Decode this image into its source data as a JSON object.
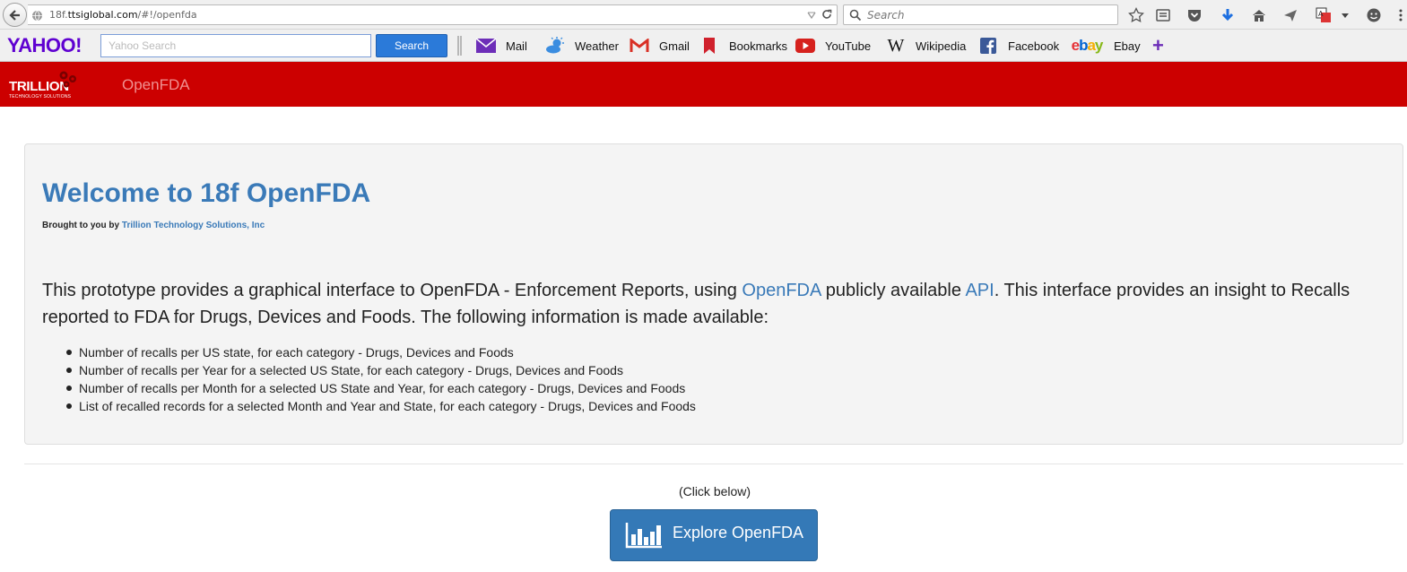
{
  "browser": {
    "url_host": "18f.ttsiglobal.com",
    "url_prefix": "18f.",
    "url_domain": "ttsiglobal.com",
    "url_path": "/#!/openfda",
    "search_placeholder": "Search"
  },
  "yahoo_toolbar": {
    "logo": "YAHOO!",
    "search_placeholder": "Yahoo Search",
    "search_button": "Search",
    "bookmarks": [
      {
        "label": "Mail",
        "icon": "mail-icon"
      },
      {
        "label": "Weather",
        "icon": "weather-icon"
      },
      {
        "label": "Gmail",
        "icon": "gmail-icon"
      },
      {
        "label": "Bookmarks",
        "icon": "bookmark-icon"
      },
      {
        "label": "YouTube",
        "icon": "youtube-icon"
      },
      {
        "label": "Wikipedia",
        "icon": "wikipedia-icon"
      },
      {
        "label": "Facebook",
        "icon": "facebook-icon"
      },
      {
        "label": "Ebay",
        "icon": "ebay-icon"
      }
    ],
    "add_label": "+"
  },
  "app_header": {
    "brand_name": "TRILLION",
    "brand_tagline": "TECHNOLOGY SOLUTIONS",
    "app_name": "OpenFDA"
  },
  "jumbotron": {
    "title": "Welcome to 18f OpenFDA",
    "byline_prefix": "Brought to you by",
    "byline_link": "Trillion Technology Solutions, Inc",
    "intro_part1": "This prototype provides a graphical interface to OpenFDA - Enforcement Reports, using ",
    "intro_link1": "OpenFDA",
    "intro_part2": " publicly available ",
    "intro_link2": "API",
    "intro_part3": ". This interface provides an insight to Recalls reported to FDA for Drugs, Devices and Foods. The following information is made available:",
    "features": [
      "Number of recalls per US state, for each category - Drugs, Devices and Foods",
      "Number of recalls per Year for a selected US State, for each category - Drugs, Devices and Foods",
      "Number of recalls per Month for a selected US State and Year, for each category - Drugs, Devices and Foods",
      "List of recalled records for a selected Month and Year and State, for each category - Drugs, Devices and Foods"
    ]
  },
  "cta": {
    "hint": "(Click below)",
    "button_label": "Explore OpenFDA"
  },
  "colors": {
    "header_red": "#cc0000",
    "link_blue": "#3a7ab8",
    "button_blue": "#3479b7",
    "yahoo_purple": "#5f01d1"
  }
}
